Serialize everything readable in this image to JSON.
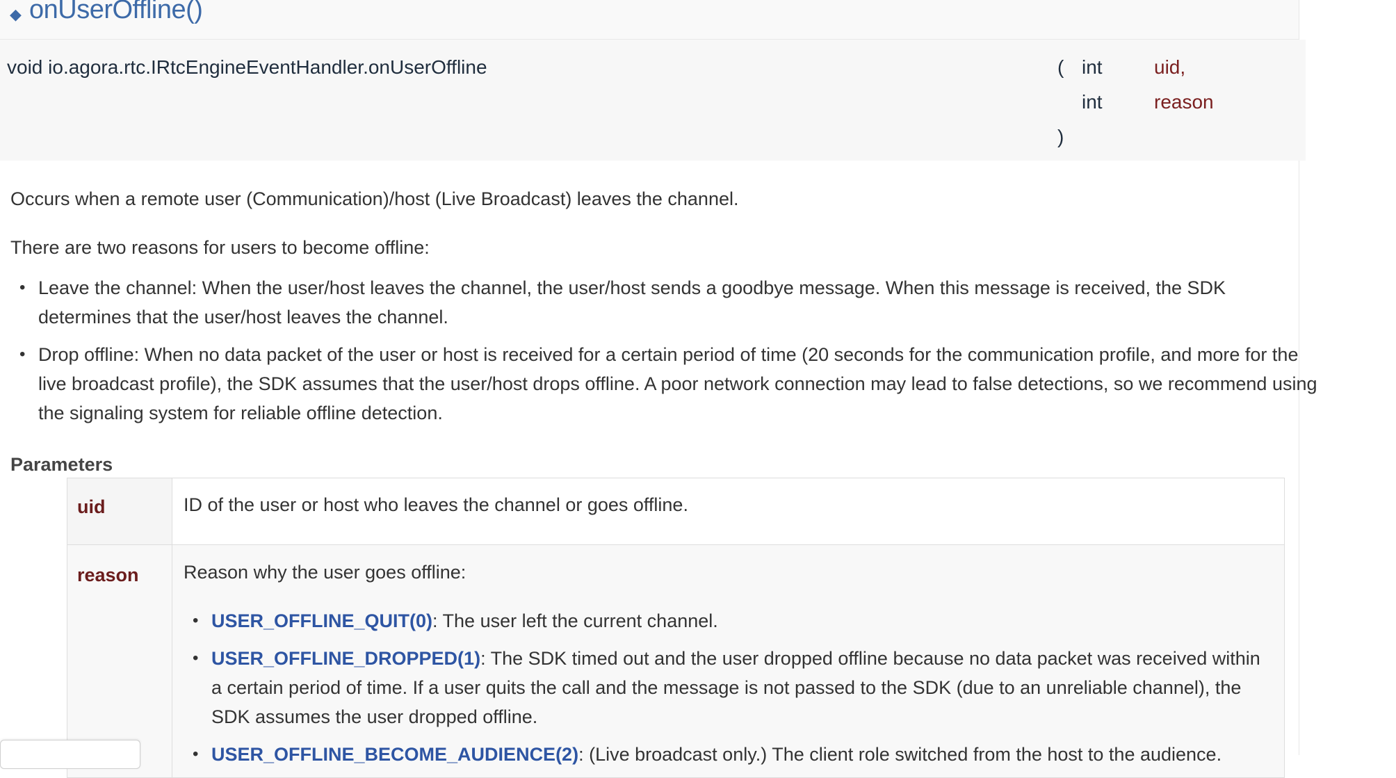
{
  "heading": {
    "title": "onUserOffline()"
  },
  "prototype": {
    "signature": "void io.agora.rtc.IRtcEngineEventHandler.onUserOffline",
    "open_paren": "(",
    "close_paren": ")",
    "params": [
      {
        "type": "int",
        "name": "uid,"
      },
      {
        "type": "int",
        "name": "reason"
      }
    ]
  },
  "description": {
    "intro": "Occurs when a remote user (Communication)/host (Live Broadcast) leaves the channel.",
    "reasons_intro": "There are two reasons for users to become offline:",
    "reasons": [
      "Leave the channel: When the user/host leaves the channel, the user/host sends a goodbye message. When this message is received, the SDK determines that the user/host leaves the channel.",
      "Drop offline: When no data packet of the user or host is received for a certain period of time (20 seconds for the communication profile, and more for the live broadcast profile), the SDK assumes that the user/host drops offline. A poor network connection may lead to false detections, so we recommend using the signaling system for reliable offline detection."
    ]
  },
  "parameters": {
    "title": "Parameters",
    "rows": [
      {
        "name": "uid",
        "description": "ID of the user or host who leaves the channel or goes offline."
      },
      {
        "name": "reason",
        "description": "Reason why the user goes offline:"
      }
    ],
    "reason_values": [
      {
        "code": "USER_OFFLINE_QUIT(0)",
        "text": ": The user left the current channel."
      },
      {
        "code": "USER_OFFLINE_DROPPED(1)",
        "text": ": The SDK timed out and the user dropped offline because no data packet was received within a certain period of time. If a user quits the call and the message is not passed to the SDK (due to an unreliable channel), the SDK assumes the user dropped offline."
      },
      {
        "code": "USER_OFFLINE_BECOME_AUDIENCE(2)",
        "text": ": (Live broadcast only.) The client role switched from the host to the audience."
      }
    ]
  },
  "colors": {
    "link": "#2e55a3",
    "param_name": "#6b1d1d",
    "heading": "#3d6aa8"
  }
}
